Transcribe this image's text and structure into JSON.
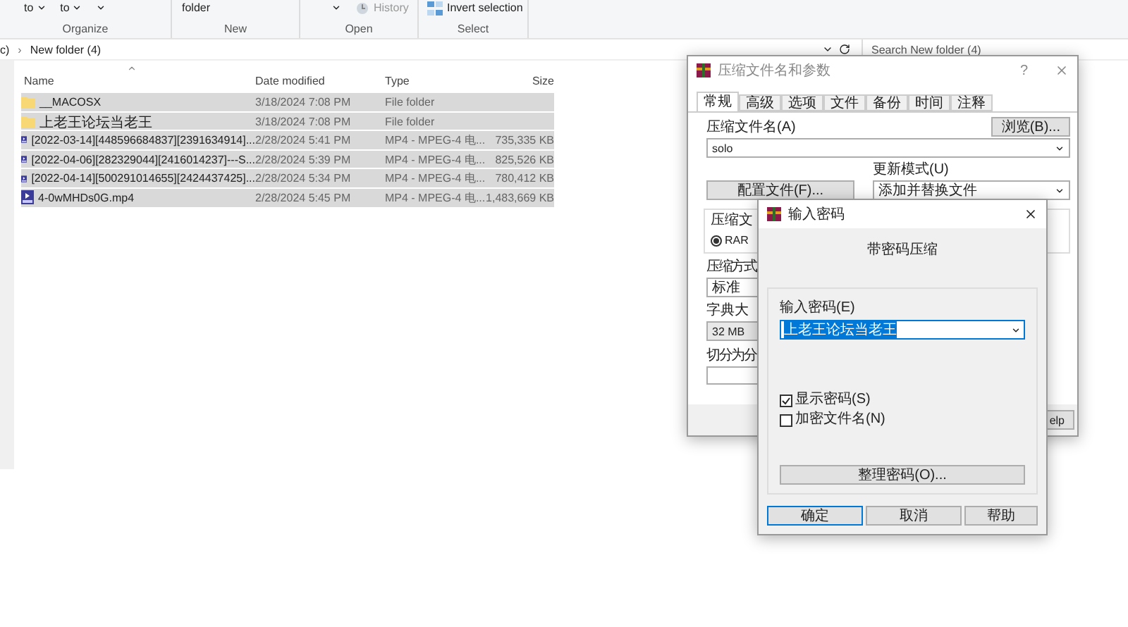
{
  "ribbon": {
    "groups": [
      {
        "label": "Organize",
        "items": [
          {
            "kind": "stack",
            "text": "to",
            "caret": true
          },
          {
            "kind": "stack",
            "text": "to",
            "caret": true
          },
          {
            "kind": "stack",
            "caret": true
          }
        ]
      },
      {
        "label": "New",
        "items": [
          {
            "kind": "stack",
            "text": "folder",
            "caret": false
          }
        ]
      },
      {
        "label": "Open",
        "items": [
          {
            "kind": "stack",
            "caret": true
          },
          {
            "kind": "wide",
            "text": "History",
            "disabled": true
          }
        ]
      },
      {
        "label": "Select",
        "items": [
          {
            "kind": "wide",
            "text": "Invert selection",
            "disabled": false
          }
        ]
      }
    ]
  },
  "address": {
    "crumbs": [
      "c)",
      "New folder (4)"
    ],
    "separator": "›",
    "search": {
      "placeholder": "Search New folder (4)"
    }
  },
  "file_list": {
    "columns": [
      "Name",
      "Date modified",
      "Type",
      "Size"
    ],
    "rows": [
      {
        "kind": "folder",
        "name": "__MACOSX",
        "date": "3/18/2024 7:08 PM",
        "type": "File folder",
        "selected": true
      },
      {
        "kind": "folder",
        "name": "上老王论坛当老王",
        "date": "3/18/2024 7:08 PM",
        "type": "File folder",
        "selected": true
      },
      {
        "kind": "video",
        "name": "[2022-03-14][448596684837][2391634914]...",
        "date": "2/28/2024 5:41 PM",
        "type": "MP4 - MPEG-4 电...",
        "size": "735,335 KB",
        "selected": true
      },
      {
        "kind": "video",
        "name": "[2022-04-06][282329044][2416014237]---S...",
        "date": "2/28/2024 5:39 PM",
        "type": "MP4 - MPEG-4 电...",
        "size": "825,526 KB",
        "selected": true
      },
      {
        "kind": "video",
        "name": "[2022-04-14][500291014655][2424437425]...",
        "date": "2/28/2024 5:34 PM",
        "type": "MP4 - MPEG-4 电...",
        "size": "780,412 KB",
        "selected": true
      },
      {
        "kind": "video",
        "name": "4-0wMHDs0G.mp4",
        "date": "2/28/2024 5:45 PM",
        "type": "MP4 - MPEG-4 电...",
        "size": "1,483,669 KB",
        "selected": true
      }
    ]
  },
  "archive_dialog": {
    "title": "压缩文件名和参数",
    "help_mark": "?",
    "tabs": [
      {
        "label": "常规",
        "selected": true
      },
      {
        "label": "高级",
        "selected": false
      },
      {
        "label": "选项",
        "selected": false
      },
      {
        "label": "文件",
        "selected": false
      },
      {
        "label": "备份",
        "selected": false
      },
      {
        "label": "时间",
        "selected": false
      },
      {
        "label": "注释",
        "selected": false
      }
    ],
    "archive_name_label": "压缩文件名(A)",
    "browse_button": "浏览(B)...",
    "archive_name": "solo",
    "update_mode_label": "更新模式(U)",
    "update_mode": "添加并替换文件",
    "profiles_button": "配置文件(F)...",
    "format_label": "压缩文",
    "format_option": {
      "label": "RAR",
      "selected": true
    },
    "method_label": "压缩方式",
    "method": "标准",
    "dictionary_label": "字典大",
    "dictionary": "32 MB",
    "split_label": "切分为分",
    "help_button": "elp"
  },
  "password_dialog": {
    "title": "输入密码",
    "heading": "带密码压缩",
    "password_label": "输入密码(E)",
    "password": {
      "value": "上老王论坛当老王",
      "selected": true
    },
    "checkboxes": [
      {
        "label": "显示密码(S)",
        "checked": true
      },
      {
        "label": "加密文件名(N)",
        "checked": false
      }
    ],
    "organize_button": "整理密码(O)...",
    "buttons": [
      {
        "label": "确定",
        "default": true
      },
      {
        "label": "取消",
        "default": false
      },
      {
        "label": "帮助",
        "default": false
      }
    ]
  }
}
